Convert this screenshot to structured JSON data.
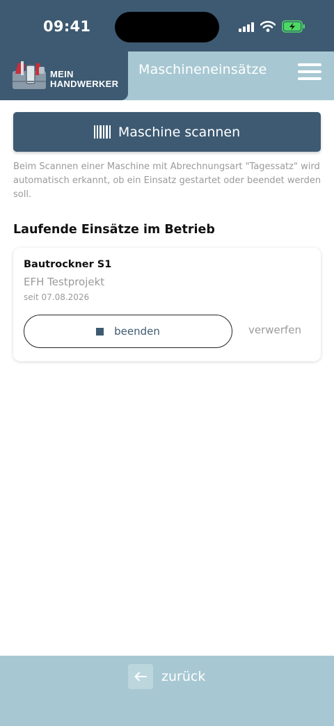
{
  "status_bar": {
    "time": "09:41"
  },
  "header": {
    "logo_line1": "MEIN",
    "logo_line2": "HANDWERKER",
    "title": "Maschineneinsätze"
  },
  "scan": {
    "button_label": "Maschine scannen",
    "help_text": "Beim Scannen einer Maschine mit Abrechnungsart \"Tagessatz\" wird automatisch erkannt, ob ein Einsatz gestartet oder beendet werden soll."
  },
  "running": {
    "section_title": "Laufende Einsätze im Betrieb",
    "items": [
      {
        "machine": "Bautrockner S1",
        "project": "EFH Testprojekt",
        "since": "seit 07.08.2026",
        "end_label": "beenden",
        "discard_label": "verwerfen"
      }
    ]
  },
  "footer": {
    "back_label": "zurück"
  },
  "colors": {
    "primary": "#3d5a72",
    "accent": "#a7c8d2",
    "muted_text": "#9a9a9a"
  },
  "icons": [
    "signal-icon",
    "wifi-icon",
    "battery-charging-icon",
    "menu-icon",
    "barcode-icon",
    "stop-icon",
    "arrow-left-icon"
  ]
}
